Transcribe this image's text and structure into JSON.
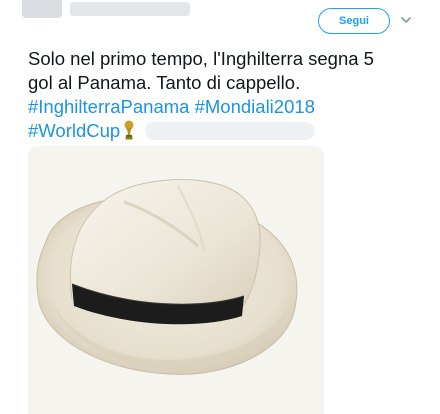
{
  "header": {
    "follow_label": "Segui"
  },
  "tweet": {
    "lines": [
      "Solo nel primo tempo, l'Inghilterra segna 5",
      "gol al Panama. Tanto di cappello."
    ],
    "hashtags": [
      "#InghilterraPanama",
      "#Mondiali2018",
      "#WorldCup"
    ]
  },
  "icons": {
    "caret": "chevron-down-icon",
    "trophy": "world-cup-trophy-icon"
  },
  "colors": {
    "accent": "#1da1f2",
    "hashtag": "#1b95e0",
    "text": "#14171a"
  }
}
